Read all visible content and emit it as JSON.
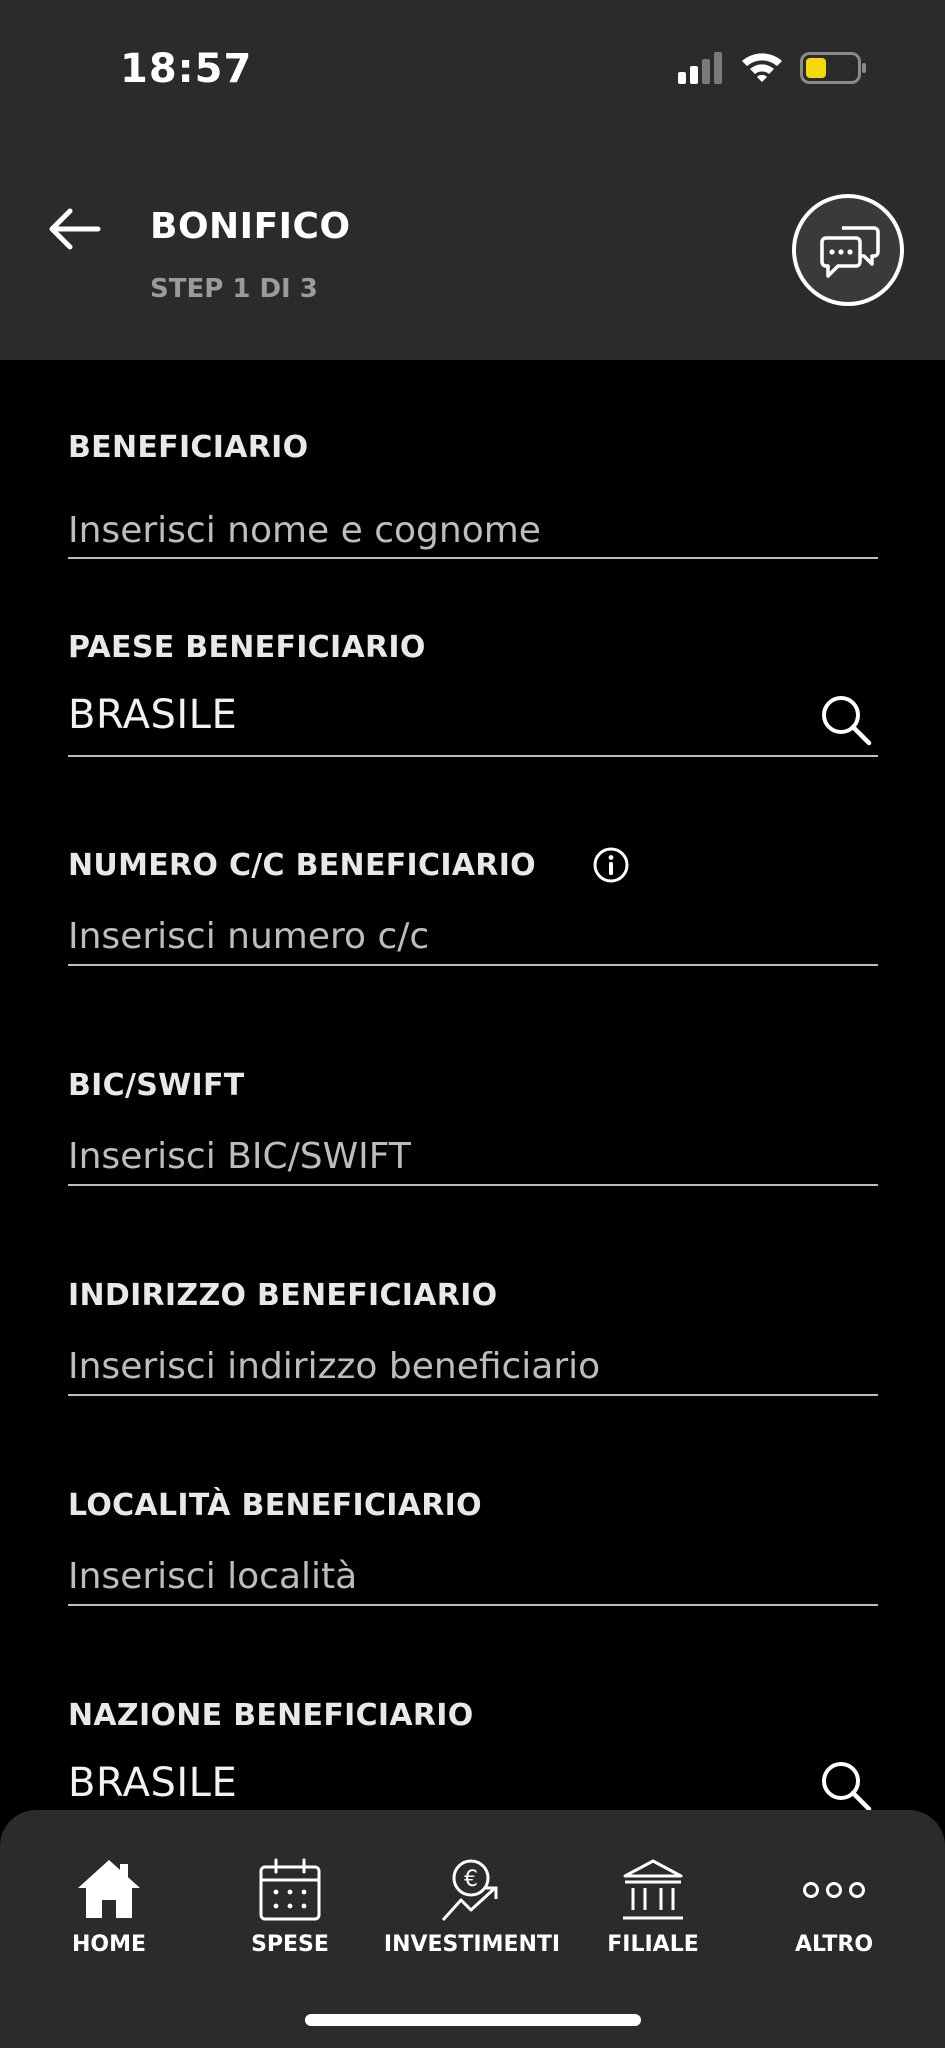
{
  "status_bar": {
    "time": "18:57",
    "icons": [
      "signal-icon",
      "wifi-icon",
      "battery-icon"
    ],
    "battery_color": "#f5d90a"
  },
  "header": {
    "title": "BONIFICO",
    "step": "STEP 1 DI 3",
    "back_icon": "back-arrow-icon",
    "chat_icon": "chat-icon"
  },
  "form": {
    "beneficiario": {
      "label": "BENEFICIARIO",
      "placeholder": "Inserisci nome e cognome",
      "value": ""
    },
    "paese": {
      "label": "PAESE BENEFICIARIO",
      "value": "BRASILE"
    },
    "numero_cc": {
      "label": "NUMERO C/C BENEFICIARIO",
      "placeholder": "Inserisci numero c/c",
      "value": ""
    },
    "bic": {
      "label": "BIC/SWIFT",
      "placeholder": "Inserisci BIC/SWIFT",
      "value": ""
    },
    "indirizzo": {
      "label": "INDIRIZZO BENEFICIARIO",
      "placeholder": "Inserisci indirizzo beneficiario",
      "value": ""
    },
    "localita": {
      "label": "LOCALITÀ BENEFICIARIO",
      "placeholder": "Inserisci località",
      "value": ""
    },
    "nazione": {
      "label": "NAZIONE BENEFICIARIO",
      "value": "BRASILE"
    }
  },
  "nav": [
    {
      "label": "HOME",
      "icon": "home-icon"
    },
    {
      "label": "SPESE",
      "icon": "calendar-icon"
    },
    {
      "label": "INVESTIMENTI",
      "icon": "investments-icon"
    },
    {
      "label": "FILIALE",
      "icon": "bank-icon"
    },
    {
      "label": "ALTRO",
      "icon": "more-icon"
    }
  ],
  "colors": {
    "background": "#000000",
    "header": "#2b2b2b",
    "placeholder": "#bdbdbd",
    "underline": "#bdbdbd"
  }
}
